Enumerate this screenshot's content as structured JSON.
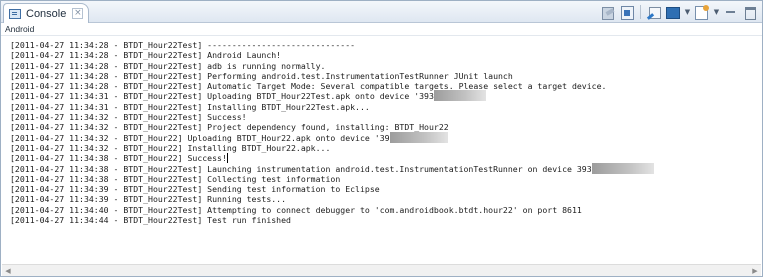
{
  "tab": {
    "label": "Console",
    "close_icon": "×"
  },
  "toolbar": {
    "icons": [
      "clear-console-icon",
      "scroll-lock-icon",
      "pin-console-icon",
      "display-selected-console-icon",
      "open-console-icon",
      "minimize-icon",
      "maximize-icon"
    ],
    "dropdown_glyph": "▼"
  },
  "subheader": {
    "label": "Android"
  },
  "log": [
    {
      "text": "[2011-04-27 11:34:28 - BTDT_Hour22Test] ------------------------------"
    },
    {
      "text": "[2011-04-27 11:34:28 - BTDT_Hour22Test] Android Launch!"
    },
    {
      "text": "[2011-04-27 11:34:28 - BTDT_Hour22Test] adb is running normally."
    },
    {
      "text": "[2011-04-27 11:34:28 - BTDT_Hour22Test] Performing android.test.InstrumentationTestRunner JUnit launch"
    },
    {
      "text": "[2011-04-27 11:34:28 - BTDT_Hour22Test] Automatic Target Mode: Several compatible targets. Please select a target device."
    },
    {
      "text": "[2011-04-27 11:34:31 - BTDT_Hour22Test] Uploading BTDT_Hour22Test.apk onto device '393",
      "redacted": true
    },
    {
      "text": "[2011-04-27 11:34:31 - BTDT_Hour22Test] Installing BTDT_Hour22Test.apk..."
    },
    {
      "text": "[2011-04-27 11:34:32 - BTDT_Hour22Test] Success!"
    },
    {
      "text": "[2011-04-27 11:34:32 - BTDT_Hour22Test] Project dependency found, installing: BTDT_Hour22"
    },
    {
      "text": "[2011-04-27 11:34:32 - BTDT_Hour22] Uploading BTDT_Hour22.apk onto device '39",
      "redacted": true
    },
    {
      "text": "[2011-04-27 11:34:32 - BTDT_Hour22] Installing BTDT_Hour22.apk..."
    },
    {
      "text": "[2011-04-27 11:34:38 - BTDT_Hour22] Success!",
      "cursor": true
    },
    {
      "text": "[2011-04-27 11:34:38 - BTDT_Hour22Test] Launching instrumentation android.test.InstrumentationTestRunner on device 393",
      "redacted": true
    },
    {
      "text": "[2011-04-27 11:34:38 - BTDT_Hour22Test] Collecting test information"
    },
    {
      "text": "[2011-04-27 11:34:39 - BTDT_Hour22Test] Sending test information to Eclipse"
    },
    {
      "text": "[2011-04-27 11:34:39 - BTDT_Hour22Test] Running tests..."
    },
    {
      "text": "[2011-04-27 11:34:40 - BTDT_Hour22Test] Attempting to connect debugger to 'com.androidbook.btdt.hour22' on port 8611"
    },
    {
      "text": "[2011-04-27 11:34:44 - BTDT_Hour22Test] Test run finished"
    }
  ],
  "scrollbar": {
    "left_arrow": "◀",
    "right_arrow": "▶"
  }
}
